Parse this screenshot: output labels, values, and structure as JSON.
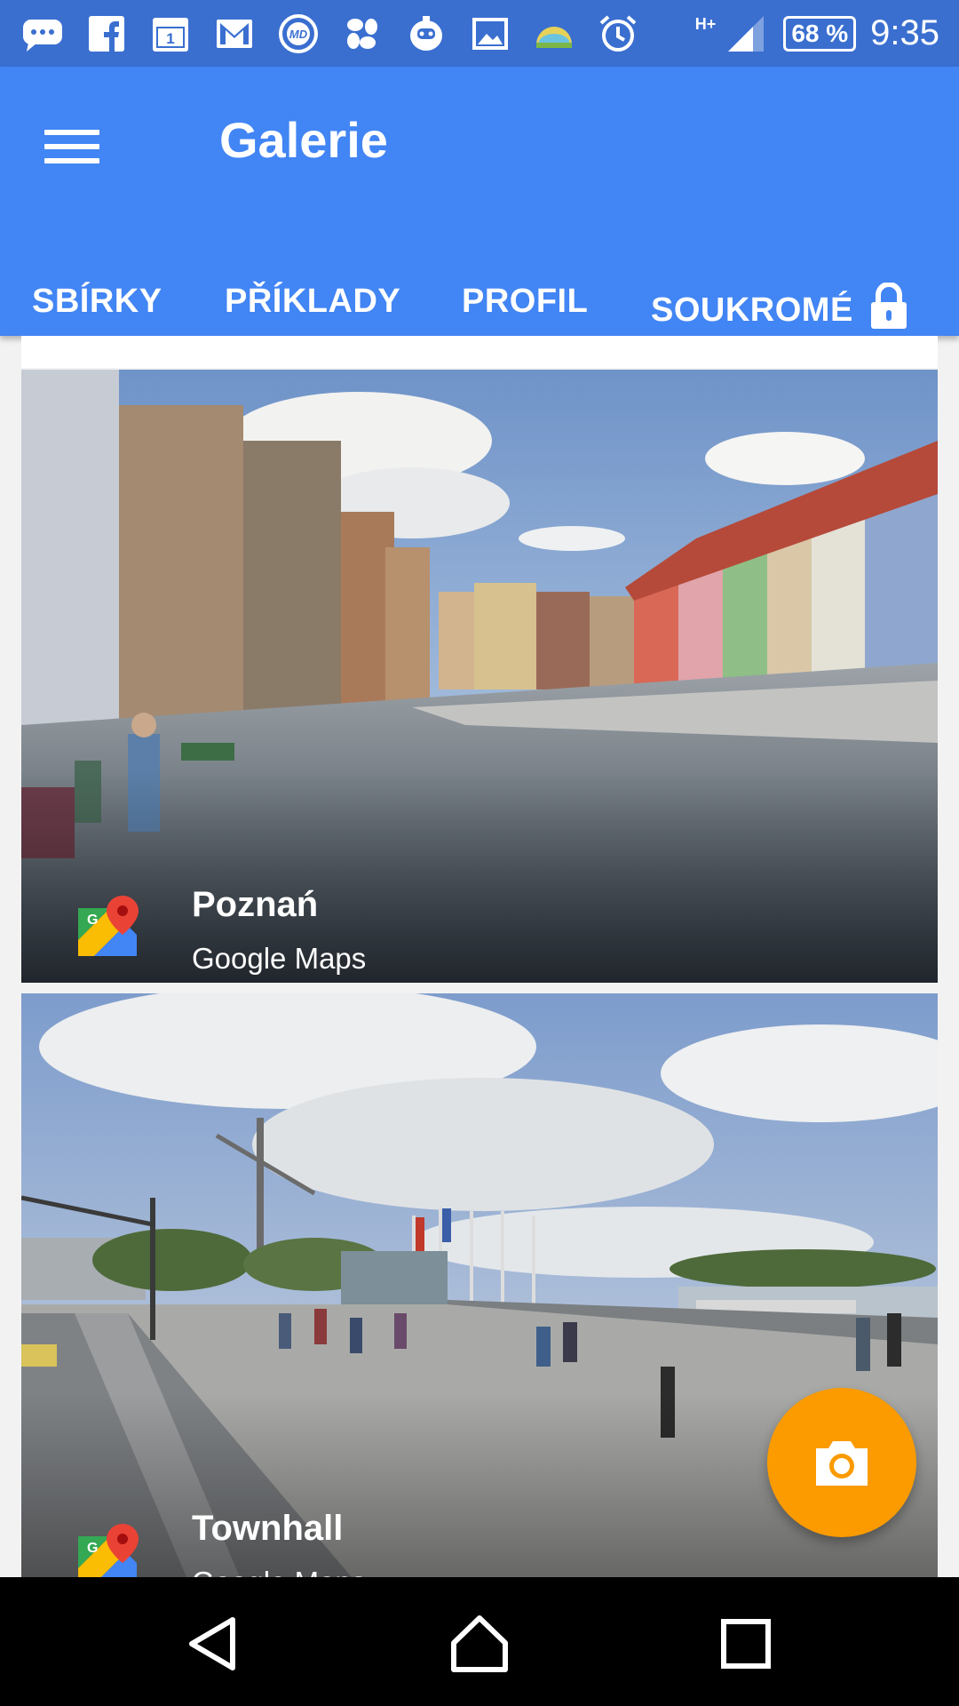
{
  "status_bar": {
    "battery": "68 %",
    "time": "9:35",
    "network": "H+",
    "icons": [
      "messages-icon",
      "facebook-icon",
      "calendar-icon",
      "gmail-icon",
      "md-icon",
      "pinwheel-icon",
      "robot-icon",
      "gallery-icon",
      "weather-icon",
      "alarm-icon",
      "signal-icon"
    ],
    "calendar_day": "1"
  },
  "app_bar": {
    "title": "Galerie",
    "menu_icon": "hamburger-menu-icon",
    "color": "#4285f4"
  },
  "tabs": [
    {
      "label": "SBÍRKY"
    },
    {
      "label": "PŘÍKLADY"
    },
    {
      "label": "PROFIL"
    },
    {
      "label": "SOUKROMÉ",
      "icon": "lock-icon"
    }
  ],
  "cards": [
    {
      "title": "Poznań",
      "subtitle": "Google Maps",
      "icon": "google-maps-icon"
    },
    {
      "title": "Townhall",
      "subtitle": "Google Maps",
      "icon": "google-maps-icon"
    }
  ],
  "fab": {
    "icon": "camera-icon",
    "color": "#fb9b00"
  },
  "nav_bar": {
    "icons": [
      "back-icon",
      "home-icon",
      "recents-icon"
    ]
  }
}
